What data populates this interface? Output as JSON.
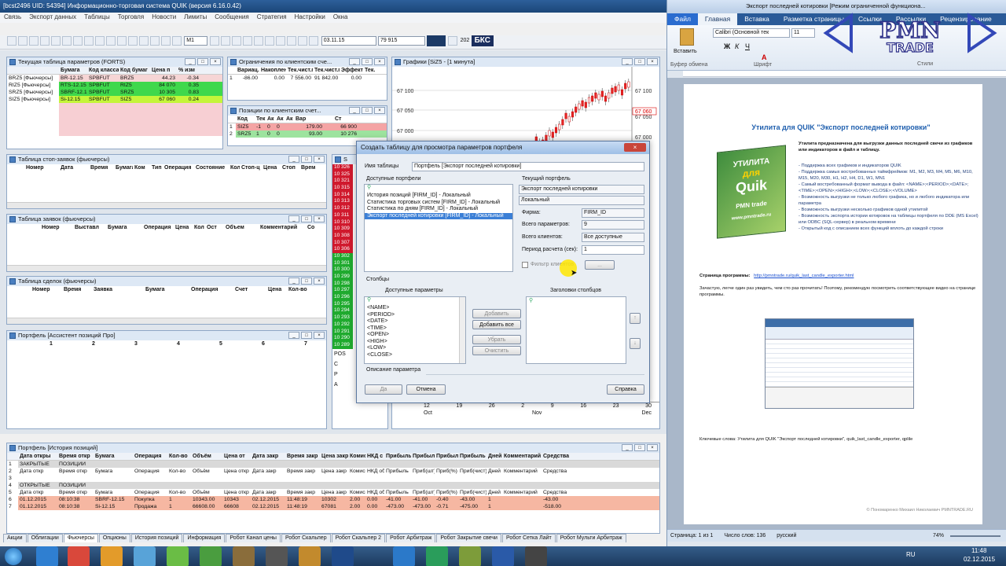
{
  "quik": {
    "title": "[bcst2496 UID: 54394] Информационно-торговая система QUIK (версия 6.16.0.42)",
    "menu": [
      "Связь",
      "Экспорт данных",
      "Таблицы",
      "Торговля",
      "Новости",
      "Лимиты",
      "Сообщения",
      "Стратегия",
      "Настройки",
      "Окна"
    ],
    "toolbar": {
      "interval": "M1",
      "date": "03.11.15",
      "value": "79 915",
      "num": "202",
      "logo": "БКС"
    },
    "params_table": {
      "title": "Текущая таблица параметров (FORTS)",
      "headers": [
        "",
        "Бумага",
        "Код класса",
        "Код бумаг",
        "Цена п",
        "% изм"
      ],
      "rows": [
        [
          "BRZ5 [Фьючерсы]",
          "BR-12.15",
          "SPBFUT",
          "BRZ5",
          "44.23",
          "-0.34"
        ],
        [
          "RIZ5 [Фьючерсы]",
          "RTS-12.15",
          "SPBFUT",
          "RIZ5",
          "84 070",
          "0.35"
        ],
        [
          "SRZ5 [Фьючерсы]",
          "SBRF-12.15",
          "SPBFUT",
          "SRZ5",
          "10 305",
          "0.83"
        ],
        [
          "SIZ5 [Фьючерсы]",
          "Si-12.15",
          "SPBFUT",
          "SIZ5",
          "67 060",
          "0.24"
        ]
      ]
    },
    "limits_table": {
      "title": "Ограничения по клиентским сче...",
      "headers": [
        "",
        "Вариац.",
        "Накоплен",
        "Тек.чист.п",
        "Тек.чист.п",
        "Эффект",
        "Тек."
      ],
      "row": [
        "1",
        "-86.00",
        "0.00",
        "7 556.00",
        "91 842.00",
        "0.00",
        ""
      ]
    },
    "positions_table": {
      "title": "Позиции по клиентским счет...",
      "headers": [
        "",
        "Код",
        "Тек",
        "Ак",
        "Ак",
        "Ак",
        "Вар",
        "Ст"
      ],
      "rows": [
        [
          "1",
          "SIZ5",
          "-1",
          "0",
          "0",
          "179.00",
          "66 900"
        ],
        [
          "2",
          "SRZ5",
          "1",
          "0",
          "0",
          "93.00",
          "10 276"
        ]
      ]
    },
    "chart": {
      "title": "Графики [SiZ5 - [1 минута]",
      "y_ticks": [
        "67 100",
        "67 050",
        "67 000"
      ],
      "last_price": "67 060",
      "lower_ticks": [
        "12",
        "19",
        "26",
        "2",
        "9",
        "16",
        "23",
        "30"
      ],
      "lower_months": [
        "Oct",
        "Nov",
        "Dec"
      ]
    },
    "stop_table": {
      "title": "Таблица стоп-заявок (фьючерсы)",
      "headers": [
        "Номер",
        "Дата",
        "Время",
        "Бумага",
        "Ком",
        "Тип",
        "Операция",
        "Состояние",
        "Кол",
        "Стоп-ц",
        "Цена",
        "Стоп",
        "Врем"
      ]
    },
    "orders_table": {
      "title": "Таблица заявок (фьючерсы)",
      "headers": [
        "Номер",
        "Выставл",
        "Бумага",
        "Операция",
        "Цена",
        "Кол",
        "Ост",
        "Объем",
        "Комментарий",
        "Со"
      ]
    },
    "deals_table": {
      "title": "Таблица сделок (фьючерсы)",
      "headers": [
        "Номер",
        "Время",
        "Заявка",
        "Бумага",
        "Операция",
        "Счет",
        "Цена",
        "Кол-во"
      ]
    },
    "portfolio_small": {
      "title": "Портфель [Ассистент позиций Про]",
      "headers": [
        "1",
        "2",
        "3",
        "4",
        "5",
        "6",
        "7"
      ]
    },
    "quotes": {
      "red": [
        "10 326",
        "10 325",
        "10 321",
        "10 315",
        "10 314",
        "10 313",
        "10 312",
        "10 311",
        "10 310",
        "10 309",
        "10 308",
        "10 307",
        "10 306"
      ],
      "green": [
        "10 302",
        "10 301",
        "10 300",
        "10 299",
        "10 298",
        "10 297",
        "10 296",
        "10 295",
        "10 294",
        "10 293",
        "10 292",
        "10 291",
        "10 290",
        "10 289"
      ],
      "footer": [
        "POS",
        "C",
        "P",
        "A"
      ]
    },
    "dialog": {
      "title": "Создать таблицу для просмотра параметров портфеля",
      "name_label": "Имя таблицы",
      "name_value": "Портфель [Экспорт последней котировки]",
      "available_label": "Доступные портфели",
      "available": [
        "История позиций [FIRM_ID] - Локальный",
        "Статистика торговых систем [FIRM_ID] - Локальный",
        "Статистика по дням [FIRM_ID] - Локальный",
        "Экспорт последней котировки [FIRM_ID] - Локальный"
      ],
      "current_label": "Текущий портфель",
      "current_value": "Экспорт последней котировки",
      "local": "Локальный",
      "firm_label": "Фирма:",
      "firm_value": "FIRM_ID",
      "params_label": "Всего параметров:",
      "params_value": "9",
      "clients_label": "Всего клиентов:",
      "clients_value": "Все доступные",
      "period_label": "Период расчета (сек):",
      "period_value": "1",
      "filter_label": "Фильтр клиентов",
      "columns_label": "Столбцы",
      "avail_params_label": "Доступные параметры",
      "headers_label": "Заголовки столбцов",
      "params": [
        "<NAME>",
        "<PERIOD>",
        "<DATE>",
        "<TIME>",
        "<OPEN>",
        "<HIGH>",
        "<LOW>",
        "<CLOSE>"
      ],
      "btn_add": "Добавить",
      "btn_add_all": "Добавить все",
      "btn_remove": "Убрать",
      "btn_clear": "Очистить",
      "desc_label": "Описание параметра",
      "btn_ok": "Да",
      "btn_cancel": "Отмена",
      "btn_help": "Справка"
    },
    "portfolio_history": {
      "title": "Портфель [История позиций]",
      "headers": [
        "",
        "Дата откры",
        "Время откр",
        "Бумага",
        "Операция",
        "Кол-во",
        "Объём",
        "Цена от",
        "Дата закр",
        "Время закр",
        "Цена закр",
        "Комис",
        "НКД с",
        "Прибыль",
        "Прибыль",
        "Прибыль",
        "Прибыль (",
        "Дней",
        "Комментарий",
        "Средства"
      ],
      "rows": [
        {
          "cls": "g",
          "cells": [
            "1",
            "ЗАКРЫТЫЕ",
            "ПОЗИЦИИ"
          ]
        },
        {
          "cls": "w",
          "cells": [
            "2",
            "Дата откр",
            "Время откр",
            "Бумага",
            "Операция",
            "Кол-во",
            "Объём",
            "Цена откр",
            "Дата закр",
            "Время закр",
            "Цена закр",
            "Комисси",
            "НКД об",
            "Прибыль",
            "Приб(шт)",
            "Приб(%)",
            "Приб(чист)",
            "Дней",
            "Комментарий",
            "Средства"
          ]
        },
        {
          "cls": "w",
          "cells": [
            "3"
          ]
        },
        {
          "cls": "g",
          "cells": [
            "4",
            "ОТКРЫТЫЕ",
            "ПОЗИЦИИ"
          ]
        },
        {
          "cls": "w",
          "cells": [
            "5",
            "Дата откр",
            "Время откр",
            "Бумага",
            "Операция",
            "Кол-во",
            "Объём",
            "Цена откр",
            "Дата закр",
            "Время закр",
            "Цена закр",
            "Комисси",
            "НКД об",
            "Прибыль",
            "Приб(шт)",
            "Приб(%)",
            "Приб(чист)",
            "Дней",
            "Комментарий",
            "Средства"
          ]
        },
        {
          "cls": "p",
          "cells": [
            "6",
            "01.12.2015",
            "08:10:38",
            "SBRF-12.15",
            "Покупка",
            "1",
            "10343.00",
            "10343",
            "02.12.2015",
            "11:48:19",
            "10302",
            "2.00",
            "0.00",
            "-41.00",
            "-41.00",
            "-0.40",
            "-43.00",
            "1",
            "",
            "-43.00"
          ]
        },
        {
          "cls": "p",
          "cells": [
            "7",
            "01.12.2015",
            "08:10:38",
            "Si-12.15",
            "Продажа",
            "1",
            "66608.00",
            "66608",
            "02.12.2015",
            "11:48:19",
            "67081",
            "2.00",
            "0.00",
            "-473.00",
            "-473.00",
            "-0.71",
            "-475.00",
            "1",
            "",
            "-518.00"
          ]
        }
      ]
    },
    "bottom_tabs": [
      "Акции",
      "Облигации",
      "Фьючерсы",
      "Опционы",
      "История позиций",
      "Информация",
      "Робот Канал цены",
      "Робот Скальпер",
      "Робот Скальпер 2",
      "Робот Арбитраж",
      "Робот Закрытие свечи",
      "Робот Сетка Лайт",
      "Робот Мульти Арбитраж"
    ]
  },
  "word": {
    "title": "Экспорт последней котировки [Режим ограниченной функциона...",
    "tabs": [
      "Файл",
      "Главная",
      "Вставка",
      "Разметка страницы",
      "Ссылки",
      "Рассылки",
      "Рецензирование",
      "Вид"
    ],
    "font": "Calibri (Основной тек",
    "size": "11",
    "groups": [
      "Буфер обмена",
      "Шрифт"
    ],
    "paste": "Вставить",
    "styles": "Стили",
    "logo_main": "PMN",
    "logo_sub": "TRADE",
    "doc_title": "Утилита для QUIK \"Экспорт последней котировки\"",
    "box_lines": [
      "УТИЛИТА",
      "для",
      "Quik",
      "PMN trade",
      "www.pmntrade.ru"
    ],
    "intro": "Утилита предназначена для выгрузки данных последней свечи из графиков или индикаторов в файл и таблицу.",
    "bullets": [
      "- Поддержка всех графиков и индикаторов QUIK",
      "- Поддержка самых востребованных таймфреймов: M1, M2, M3, M4, M5, M6, M10, M15, M20, M30, H1, H2, H4, D1, W1, MN1",
      "- Самый востребованный формат вывода в файл: <NAME>;<PERIOD>;<DATE>;<TIME>;<OPEN>;<HIGH>;<LOW>;<CLOSE>;<VOLUME>",
      "- Возможность выгрузки не только любого графика, но и любого индикатора или параметра",
      "- Возможность выгрузки несколько графиков одной утилитой",
      "- Возможность экспорта истории котировок на таблицы портфеля по DDE (MS Excel) или ODBC (SQL-сервер) в реальном времени",
      "- Открытый код с описанием всех функций вплоть до каждой строки"
    ],
    "page_label": "Страница программы:",
    "page_link": "http://pmntrade.ru/quik_last_candle_exporter.html",
    "watch": "Зачастую, легче один раз увидеть, чем сто раз прочитать! Поэтому, рекомендую посмотреть соответствующее видео на странице программы.",
    "keywords": "Ключевые слова: Утилита для QUIK \"Экспорт последней котировки\", quik_last_candle_exporter, qplile",
    "copyright": "© Пономаренко Михаил Николаевич PMNTRADE.RU",
    "status": {
      "page": "Страница: 1 из 1",
      "words": "Число слов: 136",
      "lang": "русский",
      "zoom": "74%"
    }
  },
  "taskbar": {
    "lang": "RU",
    "time": "11:48",
    "date": "02.12.2015"
  }
}
